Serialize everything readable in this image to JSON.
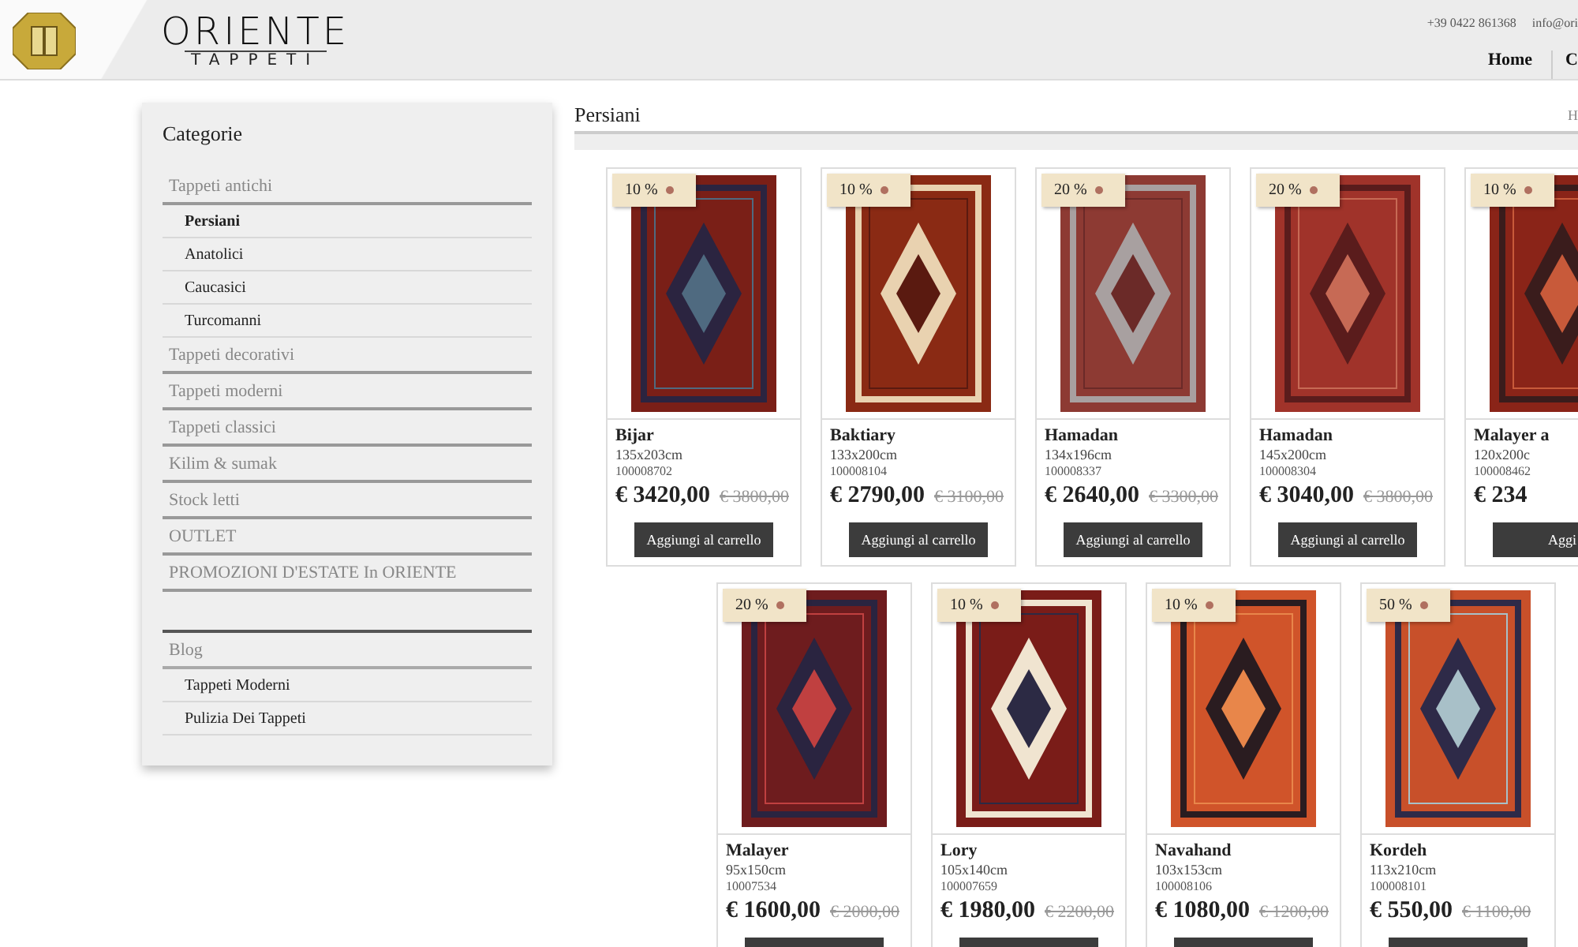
{
  "header": {
    "logo_top": "ORIENTE",
    "logo_bottom": "TAPPETI",
    "phone": "+39 0422 861368",
    "email": "info@ori",
    "nav": [
      {
        "label": "Home",
        "selected": false
      },
      {
        "label": "C",
        "selected": false
      }
    ]
  },
  "sidebar": {
    "title": "Categorie",
    "categories": [
      {
        "label": "Tappeti antichi",
        "children": [
          {
            "label": "Persiani",
            "selected": true
          },
          {
            "label": "Anatolici",
            "selected": false
          },
          {
            "label": "Caucasici",
            "selected": false
          },
          {
            "label": "Turcomanni",
            "selected": false
          }
        ]
      },
      {
        "label": "Tappeti decorativi"
      },
      {
        "label": "Tappeti moderni"
      },
      {
        "label": "Tappeti classici"
      },
      {
        "label": "Kilim & sumak"
      },
      {
        "label": "Stock letti"
      },
      {
        "label": "OUTLET"
      },
      {
        "label": "PROMOZIONI D'ESTATE In ORIENTE"
      }
    ],
    "blog": {
      "label": "Blog",
      "children": [
        {
          "label": "Tappeti Moderni",
          "selected": false
        },
        {
          "label": "Pulizia Dei Tappeti",
          "selected": false
        }
      ]
    }
  },
  "page": {
    "title": "Persiani",
    "breadcrumb": "H"
  },
  "product_rows": [
    [
      {
        "discount": "10 %",
        "name": "Bijar",
        "size": "135x203cm",
        "code": "100008702",
        "price": "€ 3420,00",
        "old_price": "€ 3800,00",
        "button": "Aggiungi al carrello"
      },
      {
        "discount": "10 %",
        "name": "Baktiary",
        "size": "133x200cm",
        "code": "100008104",
        "price": "€ 2790,00",
        "old_price": "€ 3100,00",
        "button": "Aggiungi al carrello"
      },
      {
        "discount": "20 %",
        "name": "Hamadan",
        "size": "134x196cm",
        "code": "100008337",
        "price": "€ 2640,00",
        "old_price": "€ 3300,00",
        "button": "Aggiungi al carrello"
      },
      {
        "discount": "20 %",
        "name": "Hamadan",
        "size": "145x200cm",
        "code": "100008304",
        "price": "€ 3040,00",
        "old_price": "€ 3800,00",
        "button": "Aggiungi al carrello"
      },
      {
        "discount": "10 %",
        "name": "Malayer a",
        "size": "120x200c",
        "code": "100008462",
        "price": "€ 234",
        "button": "Aggi"
      }
    ],
    [
      {
        "discount": "20 %",
        "name": "Malayer",
        "size": "95x150cm",
        "code": "10007534",
        "price": "€ 1600,00",
        "old_price": "€ 2000,00"
      },
      {
        "discount": "10 %",
        "name": "Lory",
        "size": "105x140cm",
        "code": "100007659",
        "price": "€ 1980,00",
        "old_price": "€ 2200,00"
      },
      {
        "discount": "10 %",
        "name": "Navahand",
        "size": "103x153cm",
        "code": "100008106",
        "price": "€ 1080,00",
        "old_price": "€ 1200,00"
      },
      {
        "discount": "50 %",
        "name": "Kordeh",
        "size": "113x210cm",
        "code": "100008101",
        "price": "€ 550,00",
        "old_price": "€ 1100,00"
      }
    ]
  ]
}
